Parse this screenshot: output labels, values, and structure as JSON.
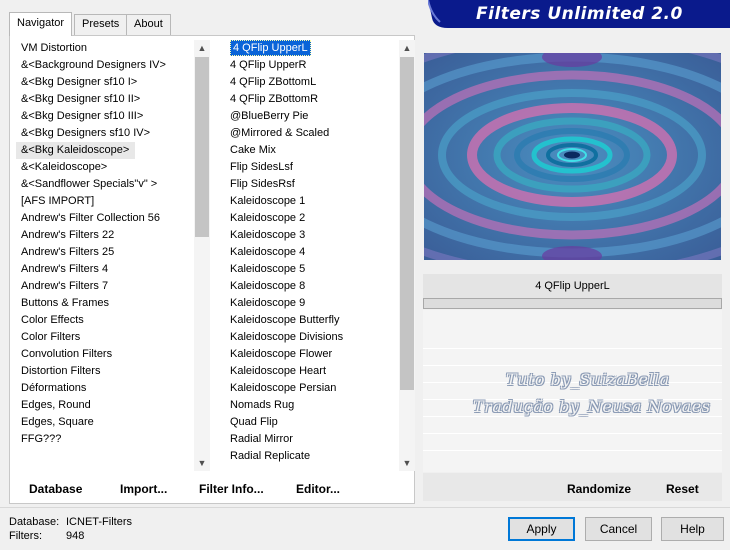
{
  "banner": {
    "title": "Filters Unlimited 2.0"
  },
  "tabs": [
    {
      "label": "Navigator"
    },
    {
      "label": "Presets"
    },
    {
      "label": "About"
    }
  ],
  "categories": [
    "VM Distortion",
    "&<Background Designers IV>",
    "&<Bkg Designer sf10 I>",
    "&<Bkg Designer sf10 II>",
    "&<Bkg Designer sf10 III>",
    "&<Bkg Designers sf10 IV>",
    "&<Bkg Kaleidoscope>",
    "&<Kaleidoscope>",
    "&<Sandflower Specials\"v\" >",
    "[AFS IMPORT]",
    "Andrew's Filter Collection 56",
    "Andrew's Filters 22",
    "Andrew's Filters 25",
    "Andrew's Filters 4",
    "Andrew's Filters 7",
    "Buttons & Frames",
    "Color Effects",
    "Color Filters",
    "Convolution Filters",
    "Distortion Filters",
    "Déformations",
    "Edges, Round",
    "Edges, Square",
    "FFG???"
  ],
  "categories_selected_index": 6,
  "filters": [
    "4 QFlip UpperL",
    "4 QFlip UpperR",
    "4 QFlip ZBottomL",
    "4 QFlip ZBottomR",
    "@BlueBerry Pie",
    "@Mirrored & Scaled",
    "Cake Mix",
    "Flip SidesLsf",
    "Flip SidesRsf",
    "Kaleidoscope 1",
    "Kaleidoscope 2",
    "Kaleidoscope 3",
    "Kaleidoscope 4",
    "Kaleidoscope 5",
    "Kaleidoscope 8",
    "Kaleidoscope 9",
    "Kaleidoscope Butterfly",
    "Kaleidoscope Divisions",
    "Kaleidoscope Flower",
    "Kaleidoscope Heart",
    "Kaleidoscope Persian",
    "Nomads Rug",
    "Quad Flip",
    "Radial Mirror",
    "Radial Replicate"
  ],
  "filters_selected_index": 0,
  "nav_buttons": {
    "database": "Database",
    "import": "Import...",
    "filter_info": "Filter Info...",
    "editor": "Editor..."
  },
  "preview": {
    "filter_name": "4 QFlip UpperL"
  },
  "right_buttons": {
    "randomize": "Randomize",
    "reset": "Reset"
  },
  "watermarks": [
    "Tuto by_SuizaBella",
    "Tradução by_Neusa Novaes"
  ],
  "footer": {
    "database_label": "Database:",
    "database_value": "ICNET-Filters",
    "filters_label": "Filters:",
    "filters_value": "948",
    "apply": "Apply",
    "cancel": "Cancel",
    "help": "Help"
  },
  "colors": {
    "banner": "#0a1a8c",
    "selection": "#0a64d8",
    "preview_base": "#3a6ea8"
  }
}
